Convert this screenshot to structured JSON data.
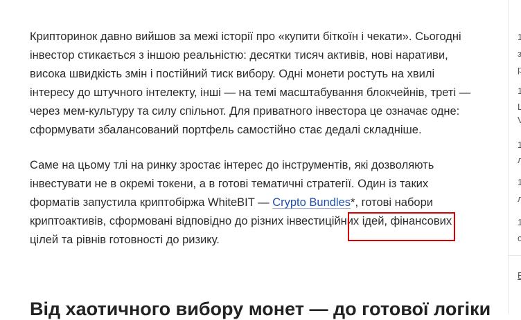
{
  "article": {
    "p1": "Крипторинок давно вийшов за межі історії про «купити біткоїн і чекати». Сьогодні інвестор стикається з іншою реальністю: десятки тисяч активів, нові наративи, висока швидкість змін і постійний тиск вибору. Одні монети ростуть на хвилі інтересу до штучного інтелекту, інші — на темі масштабування блокчейнів, треті — через мем-культуру та силу спільнот. Для приватного інвестора це означає одне: сформувати збалансований портфель самостійно стає дедалі складніше.",
    "p2_before_link": "Саме на цьому тлі на ринку зростає інтерес до інструментів, які дозволяють інвестувати не в окремі токени, а в готові тематичні стратегії. Один із таких форматів запустила криптобіржа WhiteBIT — ",
    "p2_link": "Crypto Bundles",
    "p2_after_link": "*, готові набори криптоактивів, сформовані відповідно до різних інвестиційних ідей, фінансових цілей та рівнів готовності до ризику.",
    "heading": "Від хаотичного вибору монет — до готової логіки"
  },
  "sidebar": {
    "snippets": [
      "1",
      "з",
      "р",
      "1",
      "L",
      "V",
      "1",
      "л",
      "1",
      "л",
      "1",
      "с",
      "Б"
    ]
  }
}
